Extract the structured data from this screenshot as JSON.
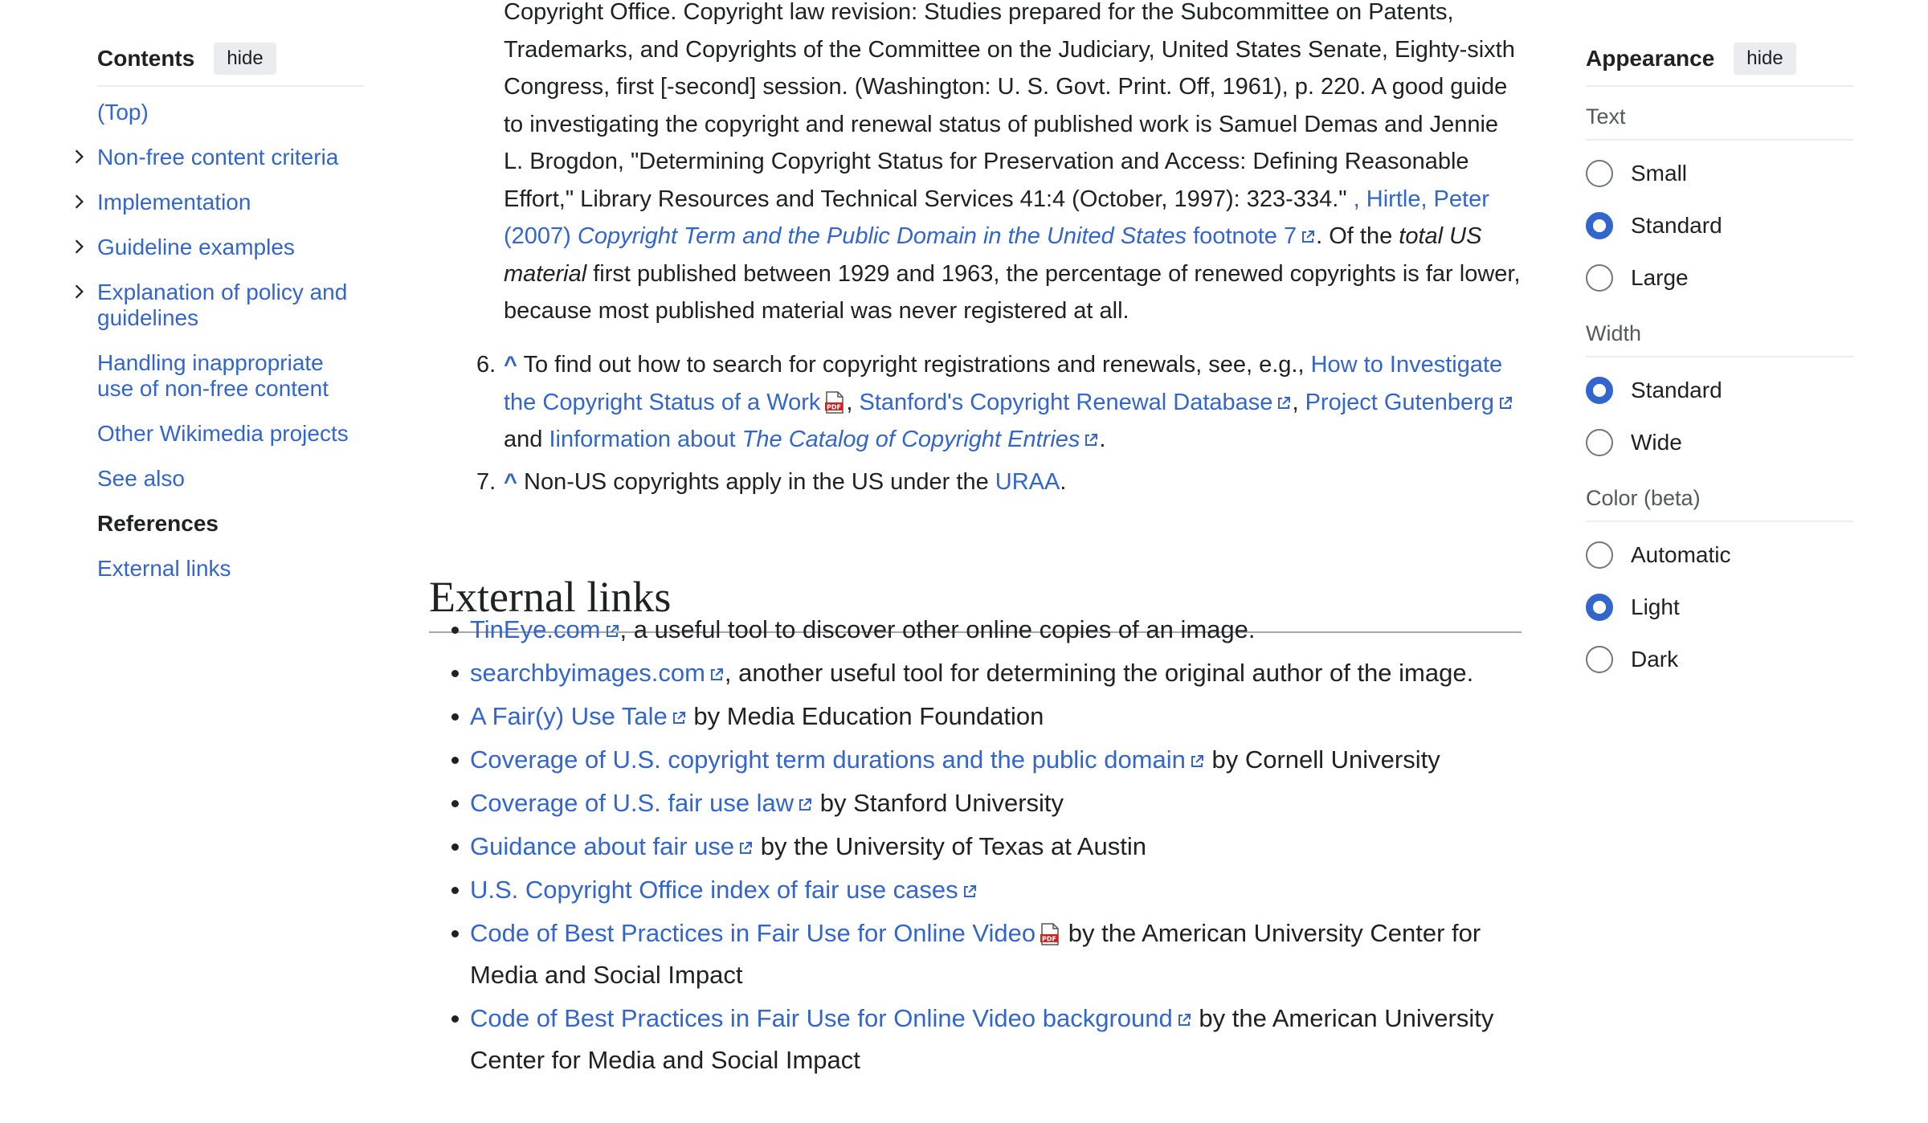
{
  "toc": {
    "title": "Contents",
    "hide_label": "hide",
    "items": [
      {
        "label": "(Top)"
      },
      {
        "label": "Non-free content criteria"
      },
      {
        "label": "Implementation"
      },
      {
        "label": "Guideline examples"
      },
      {
        "label": "Explanation of policy and guidelines"
      },
      {
        "label": "Handling inappropriate use of non-free content"
      },
      {
        "label": "Other Wikimedia projects"
      },
      {
        "label": "See also"
      },
      {
        "label": "References"
      },
      {
        "label": "External links"
      }
    ]
  },
  "references": {
    "continuation": {
      "text1": "Copyright Office. Copyright law revision: Studies prepared for the Subcommittee on Patents, Trademarks, and Copyrights of the Committee on the Judiciary, United States Senate, Eighty-sixth Congress, first [-second] session. (Washington: U. S. Govt. Print. Off, 1961), p. 220. A good guide to investigating the copyright and renewal status of published work is Samuel Demas and Jennie L. Brogdon, \"Determining Copyright Status for Preservation and Access: Defining Reasonable Effort,\" Library Resources and Technical Services 41:4 (October, 1997): 323-334.\"",
      "link1": ", Hirtle, Peter (2007)",
      "link2": "Copyright Term and the Public Domain in the United States",
      "link3": "footnote 7",
      "text2": ". Of the",
      "italic": "total US material",
      "text3": "first published between 1929 and 1963, the percentage of renewed copyrights is far lower, because most published material was never registered at all."
    },
    "ref6": {
      "num": "6.",
      "caret": "^",
      "text1": "To find out how to search for copyright registrations and renewals, see, e.g.,",
      "link1": "How to Investigate the Copyright Status of a Work",
      "sep1": ",",
      "link2": "Stanford's Copyright Renewal Database",
      "sep2": ",",
      "link3": "Project Gutenberg",
      "and": "and",
      "link4a": "Iinformation about",
      "link4b": "The Catalog of Copyright Entries",
      "end": "."
    },
    "ref7": {
      "num": "7.",
      "caret": "^",
      "text1": "Non-US copyrights apply in the US under the",
      "link": "URAA",
      "end": "."
    }
  },
  "external_links": {
    "heading": "External links",
    "items": [
      {
        "link": "TinEye.com",
        "pdf": false,
        "text": ", a useful tool to discover other online copies of an image."
      },
      {
        "link": "searchbyimages.com",
        "pdf": false,
        "text": ", another useful tool for determining the original author of the image."
      },
      {
        "link": "A Fair(y) Use Tale",
        "pdf": false,
        "text": " by Media Education Foundation"
      },
      {
        "link": "Coverage of U.S. copyright term durations and the public domain",
        "pdf": false,
        "text": " by Cornell University"
      },
      {
        "link": "Coverage of U.S. fair use law",
        "pdf": false,
        "text": " by Stanford University"
      },
      {
        "link": "Guidance about fair use",
        "pdf": false,
        "text": " by the University of Texas at Austin"
      },
      {
        "link": "U.S. Copyright Office index of fair use cases",
        "pdf": false,
        "text": ""
      },
      {
        "link": "Code of Best Practices in Fair Use for Online Video",
        "pdf": true,
        "text": " by the American University Center for Media and Social Impact"
      },
      {
        "link": "Code of Best Practices in Fair Use for Online Video background",
        "pdf": false,
        "text": " by the American University Center for Media and Social Impact"
      }
    ]
  },
  "appearance": {
    "title": "Appearance",
    "hide_label": "hide",
    "groups": [
      {
        "label": "Text",
        "options": [
          {
            "label": "Small",
            "checked": false
          },
          {
            "label": "Standard",
            "checked": true
          },
          {
            "label": "Large",
            "checked": false
          }
        ]
      },
      {
        "label": "Width",
        "options": [
          {
            "label": "Standard",
            "checked": true
          },
          {
            "label": "Wide",
            "checked": false
          }
        ]
      },
      {
        "label": "Color (beta)",
        "options": [
          {
            "label": "Automatic",
            "checked": false
          },
          {
            "label": "Light",
            "checked": true
          },
          {
            "label": "Dark",
            "checked": false
          }
        ]
      }
    ]
  },
  "colors": {
    "link": "#3366cc",
    "text": "#202122",
    "accent": "#3366cc",
    "muted": "#54595d"
  }
}
